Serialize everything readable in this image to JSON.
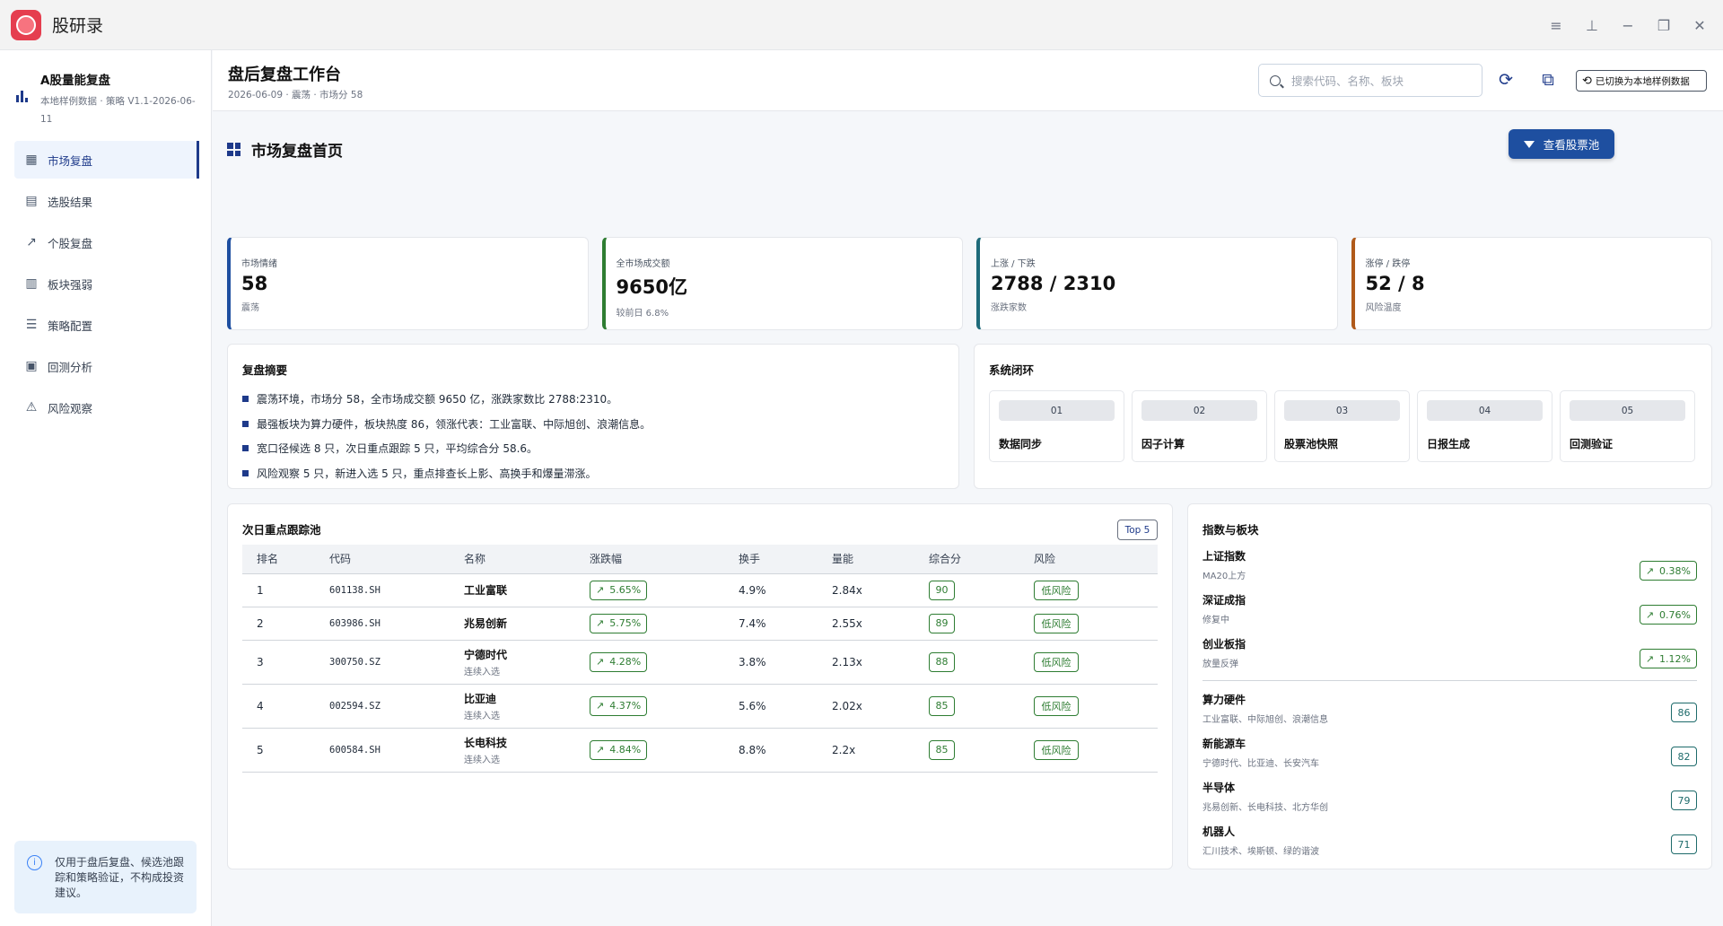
{
  "app": {
    "title": "股研录"
  },
  "window_controls": [
    "menu-icon",
    "pin-icon",
    "minimize-icon",
    "restore-icon",
    "close-icon"
  ],
  "sidebar": {
    "brand_title": "A股量能复盘",
    "brand_sub": "本地样例数据 · 策略 V1.1-2026-06-11",
    "items": [
      {
        "label": "市场复盘",
        "icon": "dashboard-icon",
        "active": true
      },
      {
        "label": "选股结果",
        "icon": "table-icon"
      },
      {
        "label": "个股复盘",
        "icon": "trend-icon"
      },
      {
        "label": "板块强弱",
        "icon": "bar-chart-icon"
      },
      {
        "label": "策略配置",
        "icon": "sliders-icon"
      },
      {
        "label": "回测分析",
        "icon": "analytics-icon"
      },
      {
        "label": "风险观察",
        "icon": "warning-icon"
      }
    ],
    "notice": "仅用于盘后复盘、候选池跟踪和策略验证，不构成投资建议。"
  },
  "header": {
    "title": "盘后复盘工作台",
    "sub": "2026-06-09 · 震荡 · 市场分 58",
    "search_placeholder": "搜索代码、名称、板块",
    "switch_label": "已切换为本地样例数据"
  },
  "page": {
    "title": "市场复盘首页",
    "action_label": "查看股票池"
  },
  "kpis": [
    {
      "label": "市场情绪",
      "value": "58",
      "note": "震荡",
      "color": "#1e4fa0"
    },
    {
      "label": "全市场成交额",
      "value": "9650亿",
      "note": "较前日 6.8%",
      "color": "#2e7d32"
    },
    {
      "label": "上涨 / 下跌",
      "value": "2788 / 2310",
      "note": "涨跌家数",
      "color": "#1e6b7a"
    },
    {
      "label": "涨停 / 跌停",
      "value": "52 / 8",
      "note": "风险温度",
      "color": "#b05a1a"
    }
  ],
  "summary": {
    "title": "复盘摘要",
    "lines": [
      "震荡环境，市场分 58，全市场成交额 9650 亿，涨跌家数比 2788:2310。",
      "最强板块为算力硬件，板块热度 86，领涨代表：工业富联、中际旭创、浪潮信息。",
      "宽口径候选 8 只，次日重点跟踪 5 只，平均综合分 58.6。",
      "风险观察 5 只，新进入选 5 只，重点排查长上影、高换手和爆量滞涨。"
    ]
  },
  "loop": {
    "title": "系统闭环",
    "steps": [
      {
        "num": "01",
        "name": "数据同步"
      },
      {
        "num": "02",
        "name": "因子计算"
      },
      {
        "num": "03",
        "name": "股票池快照"
      },
      {
        "num": "04",
        "name": "日报生成"
      },
      {
        "num": "05",
        "name": "回测验证"
      }
    ]
  },
  "track": {
    "title": "次日重点跟踪池",
    "badge": "Top 5",
    "columns": [
      "排名",
      "代码",
      "名称",
      "涨跌幅",
      "换手",
      "量能",
      "综合分",
      "风险"
    ],
    "rows": [
      {
        "rank": "1",
        "code": "601138.SH",
        "name": "工业富联",
        "sub": "",
        "chg": "5.65%",
        "turnover": "4.9%",
        "vol": "2.84x",
        "score": "90",
        "risk": "低风险"
      },
      {
        "rank": "2",
        "code": "603986.SH",
        "name": "兆易创新",
        "sub": "",
        "chg": "5.75%",
        "turnover": "7.4%",
        "vol": "2.55x",
        "score": "89",
        "risk": "低风险"
      },
      {
        "rank": "3",
        "code": "300750.SZ",
        "name": "宁德时代",
        "sub": "连续入选",
        "chg": "4.28%",
        "turnover": "3.8%",
        "vol": "2.13x",
        "score": "88",
        "risk": "低风险"
      },
      {
        "rank": "4",
        "code": "002594.SZ",
        "name": "比亚迪",
        "sub": "连续入选",
        "chg": "4.37%",
        "turnover": "5.6%",
        "vol": "2.02x",
        "score": "85",
        "risk": "低风险"
      },
      {
        "rank": "5",
        "code": "600584.SH",
        "name": "长电科技",
        "sub": "连续入选",
        "chg": "4.84%",
        "turnover": "8.8%",
        "vol": "2.2x",
        "score": "85",
        "risk": "低风险"
      }
    ]
  },
  "indices": {
    "title": "指数与板块",
    "index_items": [
      {
        "name": "上证指数",
        "desc": "MA20上方",
        "chg": "0.38%"
      },
      {
        "name": "深证成指",
        "desc": "修复中",
        "chg": "0.76%"
      },
      {
        "name": "创业板指",
        "desc": "放量反弹",
        "chg": "1.12%"
      }
    ],
    "sectors": [
      {
        "name": "算力硬件",
        "desc": "工业富联、中际旭创、浪潮信息",
        "score": "86"
      },
      {
        "name": "新能源车",
        "desc": "宁德时代、比亚迪、长安汽车",
        "score": "82"
      },
      {
        "name": "半导体",
        "desc": "兆易创新、长电科技、北方华创",
        "score": "79"
      },
      {
        "name": "机器人",
        "desc": "汇川技术、埃斯顿、绿的谐波",
        "score": "71"
      }
    ]
  }
}
